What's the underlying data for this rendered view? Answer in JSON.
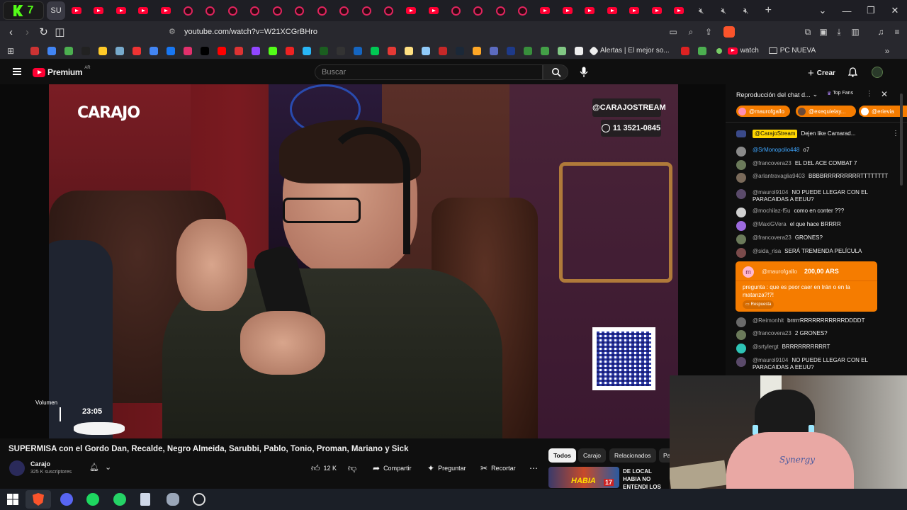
{
  "browser": {
    "kick_tile": "7",
    "active_tab_label": "SU",
    "url": "youtube.com/watch?v=W21XCGrBHro",
    "bookmarks": {
      "alertas": "Alertas | El mejor so...",
      "watch": "watch",
      "pc_nueva": "PC NUEVA"
    }
  },
  "youtube": {
    "logo_text": "Premium",
    "region": "AR",
    "search_placeholder": "Buscar",
    "create_label": "Crear"
  },
  "video": {
    "overlay_logo": "CARAJO",
    "overlay_handle": "@CARAJOSTREAM",
    "overlay_phone": "11 3521-0845",
    "volume_label": "Volumen",
    "time": "23:05",
    "title": "SUPERMISA con el Gordo Dan, Recalde, Negro Almeida, Sarubbi, Pablo, Tonio, Proman, Mariano y Sick",
    "channel": "Carajo",
    "subscribers": "325 K suscriptores",
    "likes": "12 K",
    "share_label": "Compartir",
    "ask_label": "Preguntar",
    "clip_label": "Recortar"
  },
  "related": {
    "tabs": [
      "Todos",
      "Carajo",
      "Relacionados",
      "Pa"
    ],
    "first_title": "DE LOCAL HABIA NO ENTENDI LOS",
    "thumb_text": "HABIA",
    "thumb_badge": "17"
  },
  "chat": {
    "header_title": "Reproducción del chat d...",
    "top_fans_label": "Top Fans",
    "chips": [
      "@maurofgallo",
      "@exequielay...",
      "@erievia"
    ],
    "pinned": {
      "author": "@CarajoStream",
      "text": "Dejen like Camarad..."
    },
    "messages": [
      {
        "author": "@SrMonopolio448",
        "text": "o7",
        "color": "#8a8a8a"
      },
      {
        "author": "@francovera23",
        "text": "EL DEL ACE COMBAT 7",
        "color": "#6b7a5a"
      },
      {
        "author": "@arlantravaglia9403",
        "text": "BBBBRRRRRRRRRTTTTTTTT",
        "color": "#7a6a5a"
      },
      {
        "author": "@maurol9104",
        "text": "NO PUEDE LLEGAR CON EL PARACAIDAS A EEUU?",
        "color": "#5a4a6a"
      },
      {
        "author": "@mochilaz-f5u",
        "text": "como en conter ???",
        "color": "#d0d0d0"
      },
      {
        "author": "@MaxiGVera",
        "text": "el que hace BRRRR",
        "color": "#9c6ade"
      },
      {
        "author": "@francovera23",
        "text": "GRONES?",
        "color": "#6b7a5a"
      },
      {
        "author": "@sida_risa",
        "text": "SERÁ TREMENDA PELÍCULA",
        "color": "#7a4a4a"
      },
      {
        "author": "@Reimonhit",
        "text": "brrrrrRRRRRRRRRRRDDDDT",
        "color": "#6a6a6a"
      },
      {
        "author": "@francovera23",
        "text": "2 GRONES?",
        "color": "#6b7a5a"
      },
      {
        "author": "@srtylergt",
        "text": "BRRRRRRRRRRT",
        "color": "#2ec4b6"
      },
      {
        "author": "@maurol9104",
        "text": "NO PUEDE LLEGAR CON EL PARACAIDAS A EEUU?",
        "color": "#5a4a6a"
      }
    ],
    "superchat": {
      "author": "@maurofgallo",
      "amount": "200,00 ARS",
      "initial": "m",
      "text": "pregunta : que es peor caer en Irán o en la matanza?!?!",
      "reply_label": "Respuesta",
      "color": "#f57c00"
    }
  },
  "webcam": {
    "shirt_text": "Synergy"
  },
  "colors": {
    "yt_red": "#ff0033",
    "kick_green": "#53fc18",
    "superchat_orange": "#f57c00"
  }
}
